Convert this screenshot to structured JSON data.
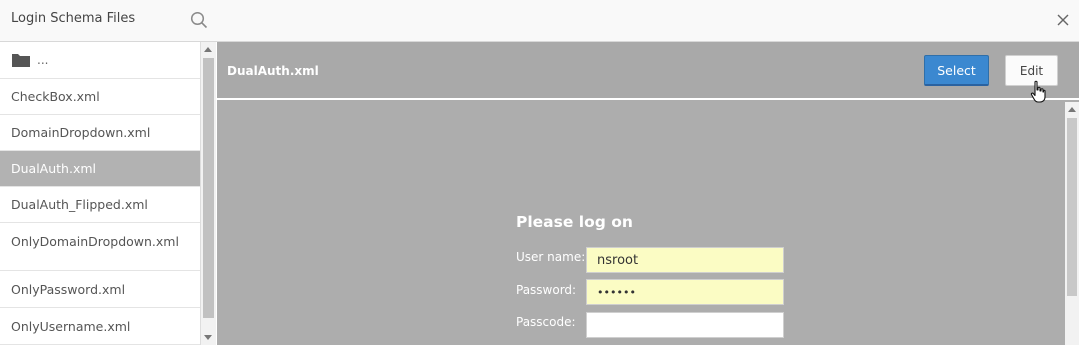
{
  "header": {
    "title": "Login Schema Files"
  },
  "sidebar": {
    "folder_label": "...",
    "items": [
      {
        "label": "CheckBox.xml"
      },
      {
        "label": "DomainDropdown.xml"
      },
      {
        "label": "DualAuth.xml",
        "selected": true
      },
      {
        "label": "DualAuth_Flipped.xml"
      },
      {
        "label": "OnlyDomainDropdown.xml"
      },
      {
        "label": "OnlyPassword.xml"
      },
      {
        "label": "OnlyUsername.xml"
      }
    ]
  },
  "main": {
    "file_title": "DualAuth.xml",
    "select_label": "Select",
    "edit_label": "Edit"
  },
  "preview": {
    "heading": "Please log on",
    "username_label": "User name:",
    "username_value": "nsroot",
    "password_label": "Password:",
    "password_value": "••••••",
    "passcode_label": "Passcode:",
    "passcode_value": ""
  },
  "colors": {
    "accent": "#3b88d0",
    "selected_row": "#b2b2b2",
    "preview_bg": "#adadad",
    "input_highlight": "#fbfcc4"
  },
  "icons": [
    "search-icon",
    "close-icon",
    "folder-icon",
    "hand-cursor-icon"
  ]
}
